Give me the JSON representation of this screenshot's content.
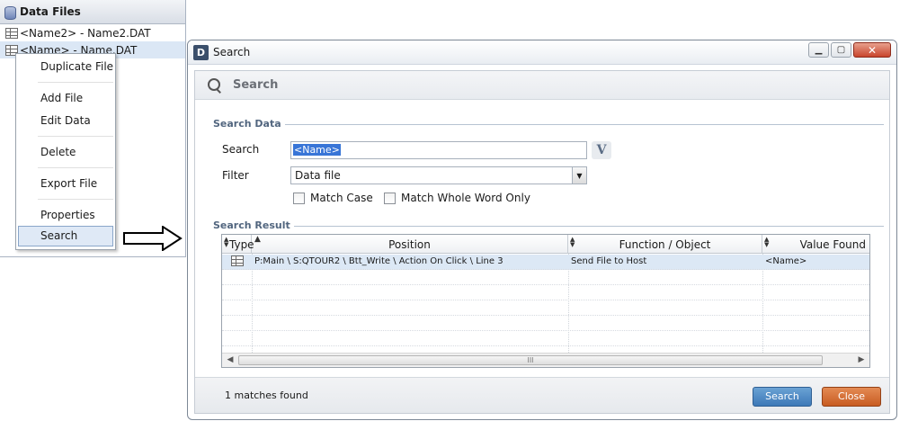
{
  "left_panel": {
    "title": "Data Files",
    "items": [
      "<Name2> - Name2.DAT",
      "<Name> - Name.DAT"
    ]
  },
  "context_menu": {
    "items": [
      "Duplicate File",
      "Add File",
      "Edit Data",
      "Delete",
      "Export File",
      "Properties",
      "Search"
    ]
  },
  "dialog": {
    "title": "Search",
    "app_icon": "D",
    "banner_title": "Search",
    "search_data": {
      "section_label": "Search Data",
      "search_label": "Search",
      "search_value": "<Name>",
      "v_button": "V",
      "filter_label": "Filter",
      "filter_value": "Data file",
      "match_case": "Match Case",
      "match_whole_word": "Match Whole Word Only"
    },
    "search_result": {
      "section_label": "Search Result",
      "columns": [
        "Type",
        "Position",
        "Function / Object",
        "Value Found"
      ],
      "rows": [
        {
          "position": "P:Main \\ S:QTOUR2 \\ Btt_Write \\ Action On Click \\  Line 3",
          "function": "Send File to Host",
          "value": "<Name>"
        }
      ],
      "scroll_label": "III"
    },
    "status": "1 matches found",
    "buttons": {
      "search": "Search",
      "close": "Close"
    }
  },
  "colors": {
    "accent_blue": "#3d79b8",
    "close_orange": "#c85c22",
    "selection": "#dce8f5"
  }
}
